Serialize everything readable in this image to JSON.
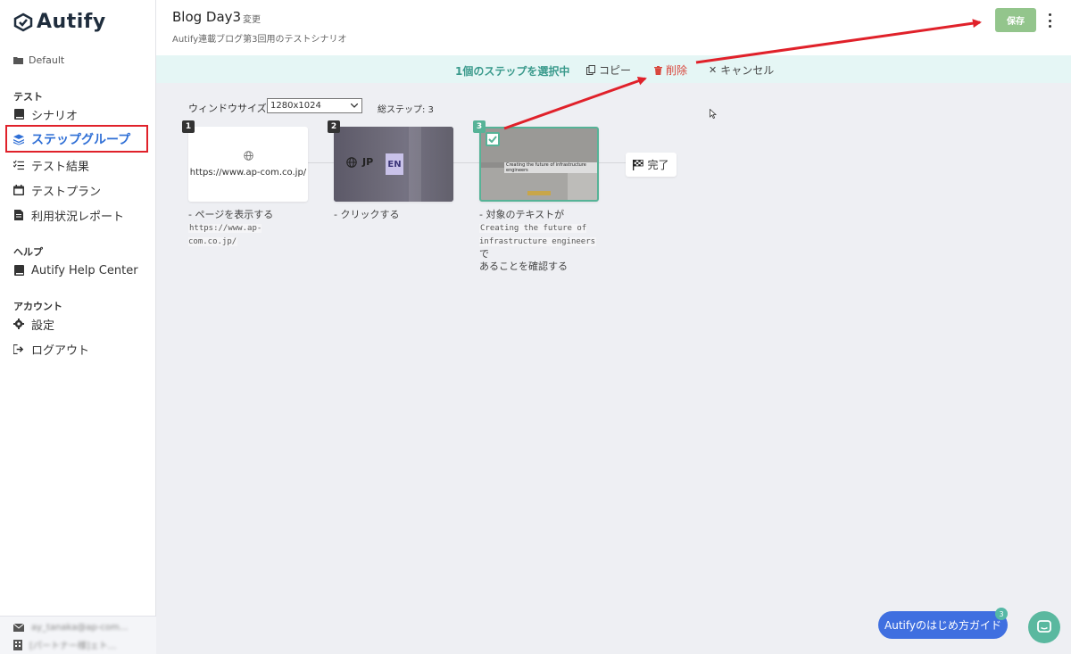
{
  "sidebar": {
    "logo": "Autify",
    "folder": "Default",
    "test_section": "テスト",
    "items": [
      {
        "label": "シナリオ",
        "icon": "book-icon"
      },
      {
        "label": "ステップグループ",
        "icon": "layers-icon",
        "active": true
      },
      {
        "label": "テスト結果",
        "icon": "checklist-icon"
      },
      {
        "label": "テストプラン",
        "icon": "calendar-icon"
      },
      {
        "label": "利用状況レポート",
        "icon": "report-icon"
      }
    ],
    "help_section": "ヘルプ",
    "help_item": "Autify Help Center",
    "account_section": "アカウント",
    "settings": "設定",
    "logout": "ログアウト",
    "footer_email": "ay_tanaka@ap-com...",
    "footer_org": "[パートナー様]ェト..."
  },
  "header": {
    "title": "Blog Day3",
    "change_link": "変更",
    "subtitle": "Autify連載ブログ第3回用のテストシナリオ",
    "save_label": "保存"
  },
  "selection_bar": {
    "count_label": "1個のステップを選択中",
    "copy_label": "コピー",
    "delete_label": "削除",
    "cancel_label": "キャンセル"
  },
  "workspace": {
    "window_size_label": "ウィンドウサイズ:",
    "window_size_value": "1280x1024",
    "total_steps_label": "総ステップ: 3"
  },
  "steps": [
    {
      "number": "1",
      "url": "https://www.ap-com.co.jp/",
      "desc_prefix": "- ページを表示する",
      "desc_code": "https://www.ap-com.co.jp/"
    },
    {
      "number": "2",
      "jp": "JP",
      "en": "EN",
      "desc_prefix": "- クリックする"
    },
    {
      "number": "3",
      "headline": "Creating the future of infrastructure engineers",
      "desc_prefix": "- 対象のテキストが",
      "desc_code": "Creating the future of infrastructure engineers",
      "desc_suffix": "で",
      "desc_suffix2": "あることを確認する",
      "selected": true
    }
  ],
  "done_label": "完了",
  "guide_label": "Autifyのはじめ方ガイド",
  "guide_badge": "3",
  "colors": {
    "accent": "#2f6fd6",
    "teal": "#56b397",
    "save_green": "#93c58c",
    "delete_red": "#d9473d",
    "annotation_red": "#e0212a"
  }
}
